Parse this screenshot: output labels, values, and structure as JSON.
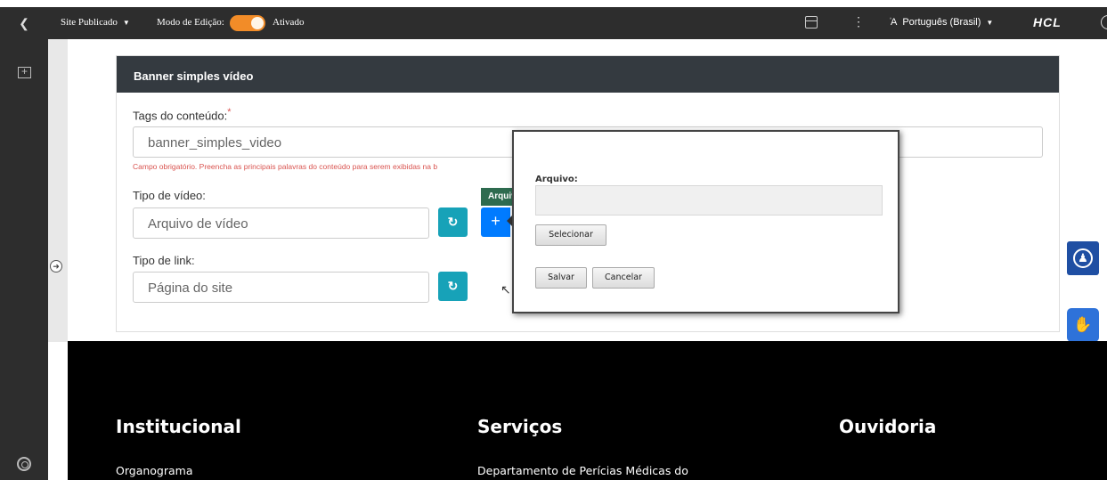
{
  "toolbar": {
    "back_icon": "chevron-left-icon",
    "site_status": "Site Publicado",
    "edit_mode_label": "Modo de Edição:",
    "edit_mode_state": "Ativado",
    "toggle_color": "#f28c28",
    "language": "Português (Brasil)",
    "brand": "HCL"
  },
  "card": {
    "title": "Banner simples vídeo",
    "tags_label": "Tags do conteúdo:",
    "tags_required": "*",
    "tags_value": "banner_simples_video",
    "tags_hint": "Campo obrigatório. Preencha as principais palavras do conteúdo para serem exibidas na b",
    "video_type_label": "Tipo de vídeo:",
    "video_type_value": "Arquivo de vídeo",
    "tooltip_text": "Arquivo",
    "link_type_label": "Tipo de link:",
    "link_type_value": "Página do site"
  },
  "modal": {
    "file_label": "Arquivo:",
    "file_value": "",
    "select_button": "Selecionar",
    "save_button": "Salvar",
    "cancel_button": "Cancelar"
  },
  "footer": {
    "col1_title": "Institucional",
    "col1_link": "Organograma",
    "col2_title": "Serviços",
    "col2_link": "Departamento de Perícias Médicas do",
    "col3_title": "Ouvidoria"
  },
  "colors": {
    "accent": "#007bff",
    "sync_button": "#17a2b8",
    "error": "#d9534f",
    "card_header": "#343a40"
  }
}
